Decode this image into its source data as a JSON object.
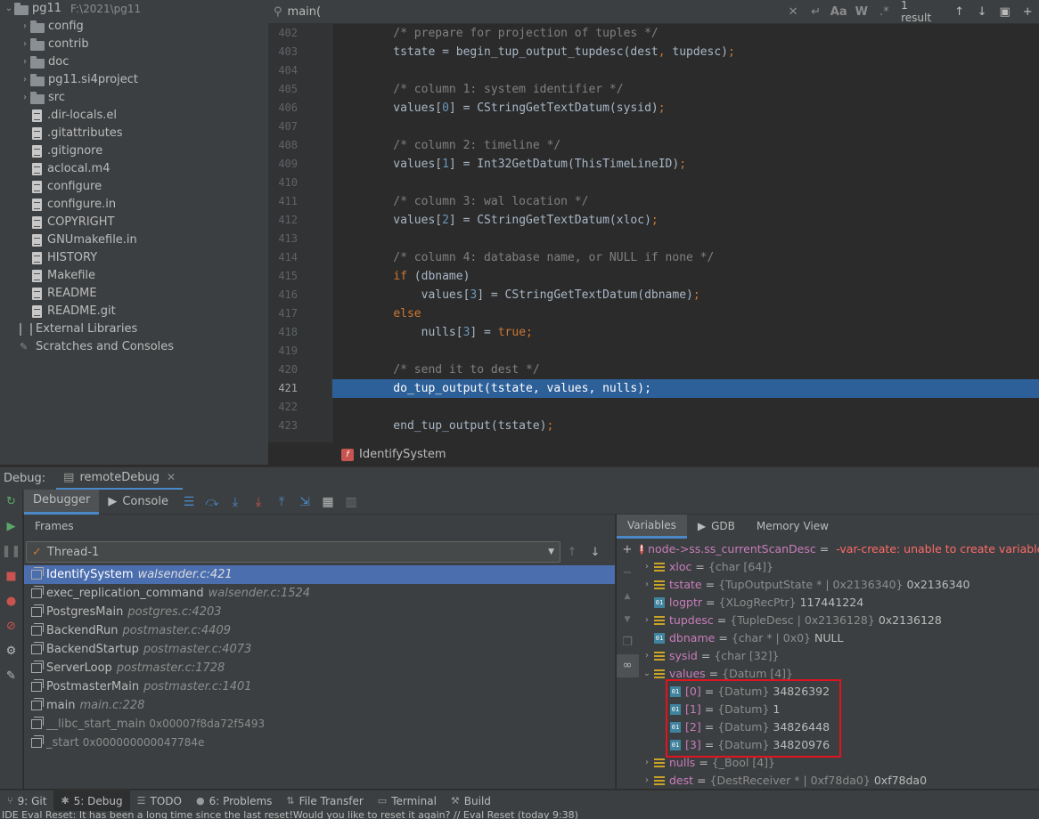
{
  "project": {
    "root_name": "pg11",
    "root_path": "F:\\2021\\pg11",
    "items": [
      {
        "label": "config",
        "kind": "folder"
      },
      {
        "label": "contrib",
        "kind": "folder"
      },
      {
        "label": "doc",
        "kind": "folder"
      },
      {
        "label": "pg11.si4project",
        "kind": "folder"
      },
      {
        "label": "src",
        "kind": "folder"
      },
      {
        "label": ".dir-locals.el",
        "kind": "file"
      },
      {
        "label": ".gitattributes",
        "kind": "file"
      },
      {
        "label": ".gitignore",
        "kind": "file"
      },
      {
        "label": "aclocal.m4",
        "kind": "file"
      },
      {
        "label": "configure",
        "kind": "file"
      },
      {
        "label": "configure.in",
        "kind": "file"
      },
      {
        "label": "COPYRIGHT",
        "kind": "file"
      },
      {
        "label": "GNUmakefile.in",
        "kind": "file"
      },
      {
        "label": "HISTORY",
        "kind": "file"
      },
      {
        "label": "Makefile",
        "kind": "file"
      },
      {
        "label": "README",
        "kind": "file"
      },
      {
        "label": "README.git",
        "kind": "file"
      }
    ],
    "external_libraries": "External Libraries",
    "scratches": "Scratches and Consoles"
  },
  "find": {
    "query": "main(",
    "result": "1 result"
  },
  "editor": {
    "lines": [
      {
        "no": "402",
        "text": "    /* prepare for projection of tuples */",
        "kind": "comment"
      },
      {
        "no": "403",
        "text": "    tstate = begin_tup_output_tupdesc(dest, tupdesc);",
        "kind": "code"
      },
      {
        "no": "404",
        "text": "",
        "kind": "code"
      },
      {
        "no": "405",
        "text": "    /* column 1: system identifier */",
        "kind": "comment"
      },
      {
        "no": "406",
        "text": "    values[0] = CStringGetTextDatum(sysid);",
        "kind": "code"
      },
      {
        "no": "407",
        "text": "",
        "kind": "code"
      },
      {
        "no": "408",
        "text": "    /* column 2: timeline */",
        "kind": "comment"
      },
      {
        "no": "409",
        "text": "    values[1] = Int32GetDatum(ThisTimeLineID);",
        "kind": "code"
      },
      {
        "no": "410",
        "text": "",
        "kind": "code"
      },
      {
        "no": "411",
        "text": "    /* column 3: wal location */",
        "kind": "comment"
      },
      {
        "no": "412",
        "text": "    values[2] = CStringGetTextDatum(xloc);",
        "kind": "code"
      },
      {
        "no": "413",
        "text": "",
        "kind": "code"
      },
      {
        "no": "414",
        "text": "    /* column 4: database name, or NULL if none */",
        "kind": "comment"
      },
      {
        "no": "415",
        "text": "    if (dbname)",
        "kind": "kw"
      },
      {
        "no": "416",
        "text": "        values[3] = CStringGetTextDatum(dbname);",
        "kind": "code"
      },
      {
        "no": "417",
        "text": "    else",
        "kind": "kw"
      },
      {
        "no": "418",
        "text": "        nulls[3] = true;",
        "kind": "code"
      },
      {
        "no": "419",
        "text": "",
        "kind": "code"
      },
      {
        "no": "420",
        "text": "    /* send it to dest */",
        "kind": "comment"
      },
      {
        "no": "421",
        "text": "    do_tup_output(tstate, values, nulls);",
        "kind": "current"
      },
      {
        "no": "422",
        "text": "",
        "kind": "code"
      },
      {
        "no": "423",
        "text": "    end_tup_output(tstate);",
        "kind": "code"
      }
    ],
    "breadcrumb_fn": "IdentifySystem",
    "breadcrumb_badge": "f"
  },
  "debug": {
    "label": "Debug:",
    "session_tab": "remoteDebug",
    "subtabs": {
      "debugger": "Debugger",
      "console": "Console"
    },
    "frames_header": "Frames",
    "thread": "Thread-1",
    "frames": [
      {
        "fn": "IdentifySystem",
        "loc": "walsender.c:421",
        "addr": "",
        "selected": true,
        "dim": false
      },
      {
        "fn": "exec_replication_command",
        "loc": "walsender.c:1524",
        "addr": "",
        "selected": false,
        "dim": false
      },
      {
        "fn": "PostgresMain",
        "loc": "postgres.c:4203",
        "addr": "",
        "selected": false,
        "dim": false
      },
      {
        "fn": "BackendRun",
        "loc": "postmaster.c:4409",
        "addr": "",
        "selected": false,
        "dim": false
      },
      {
        "fn": "BackendStartup",
        "loc": "postmaster.c:4073",
        "addr": "",
        "selected": false,
        "dim": false
      },
      {
        "fn": "ServerLoop",
        "loc": "postmaster.c:1728",
        "addr": "",
        "selected": false,
        "dim": false
      },
      {
        "fn": "PostmasterMain",
        "loc": "postmaster.c:1401",
        "addr": "",
        "selected": false,
        "dim": false
      },
      {
        "fn": "main",
        "loc": "main.c:228",
        "addr": "",
        "selected": false,
        "dim": false
      },
      {
        "fn": "__libc_start_main",
        "loc": "",
        "addr": "0x00007f8da72f5493",
        "selected": false,
        "dim": true
      },
      {
        "fn": "_start",
        "loc": "",
        "addr": "0x000000000047784e",
        "selected": false,
        "dim": true
      }
    ],
    "var_tabs": {
      "variables": "Variables",
      "gdb": "GDB",
      "memory": "Memory View"
    },
    "variables": [
      {
        "name": "node->ss.ss_currentScanDesc",
        "type": "",
        "value": "",
        "error": "-var-create: unable to create variable object",
        "icon": "err",
        "expand": "",
        "child": false
      },
      {
        "name": "xloc",
        "type": "{char [64]}",
        "value": "",
        "error": "",
        "icon": "struct",
        "expand": "›",
        "child": false
      },
      {
        "name": "tstate",
        "type": "{TupOutputState * | 0x2136340}",
        "value": "0x2136340",
        "error": "",
        "icon": "struct",
        "expand": "›",
        "child": false
      },
      {
        "name": "logptr",
        "type": "{XLogRecPtr}",
        "value": "117441224",
        "error": "",
        "icon": "prim",
        "expand": "",
        "child": false
      },
      {
        "name": "tupdesc",
        "type": "{TupleDesc | 0x2136128}",
        "value": "0x2136128",
        "error": "",
        "icon": "struct",
        "expand": "›",
        "child": false
      },
      {
        "name": "dbname",
        "type": "{char * | 0x0}",
        "value": "NULL",
        "error": "",
        "icon": "prim",
        "expand": "",
        "child": false
      },
      {
        "name": "sysid",
        "type": "{char [32]}",
        "value": "",
        "error": "",
        "icon": "struct",
        "expand": "›",
        "child": false
      },
      {
        "name": "values",
        "type": "{Datum [4]}",
        "value": "",
        "error": "",
        "icon": "struct",
        "expand": "⌄",
        "child": false
      },
      {
        "name": "[0]",
        "type": "{Datum}",
        "value": "34826392",
        "error": "",
        "icon": "prim",
        "expand": "",
        "child": true
      },
      {
        "name": "[1]",
        "type": "{Datum}",
        "value": "1",
        "error": "",
        "icon": "prim",
        "expand": "",
        "child": true
      },
      {
        "name": "[2]",
        "type": "{Datum}",
        "value": "34826448",
        "error": "",
        "icon": "prim",
        "expand": "",
        "child": true
      },
      {
        "name": "[3]",
        "type": "{Datum}",
        "value": "34820976",
        "error": "",
        "icon": "prim",
        "expand": "",
        "child": true
      },
      {
        "name": "nulls",
        "type": "{_Bool [4]}",
        "value": "",
        "error": "",
        "icon": "struct",
        "expand": "›",
        "child": false
      },
      {
        "name": "dest",
        "type": "{DestReceiver * | 0xf78da0}",
        "value": "0xf78da0",
        "error": "",
        "icon": "struct",
        "expand": "›",
        "child": false
      }
    ]
  },
  "bottom_tabs": [
    {
      "label": "9: Git",
      "icon": "git-icon",
      "active": false
    },
    {
      "label": "5: Debug",
      "icon": "bug-icon",
      "active": true
    },
    {
      "label": "TODO",
      "icon": "list-icon",
      "active": false
    },
    {
      "label": "6: Problems",
      "icon": "info-icon",
      "active": false
    },
    {
      "label": "File Transfer",
      "icon": "transfer-icon",
      "active": false
    },
    {
      "label": "Terminal",
      "icon": "terminal-icon",
      "active": false
    },
    {
      "label": "Build",
      "icon": "hammer-icon",
      "active": false
    }
  ],
  "status": "IDE Eval Reset: It has been a long time since the last reset!Would you like to reset it again? // Eval Reset (today 9:38)"
}
